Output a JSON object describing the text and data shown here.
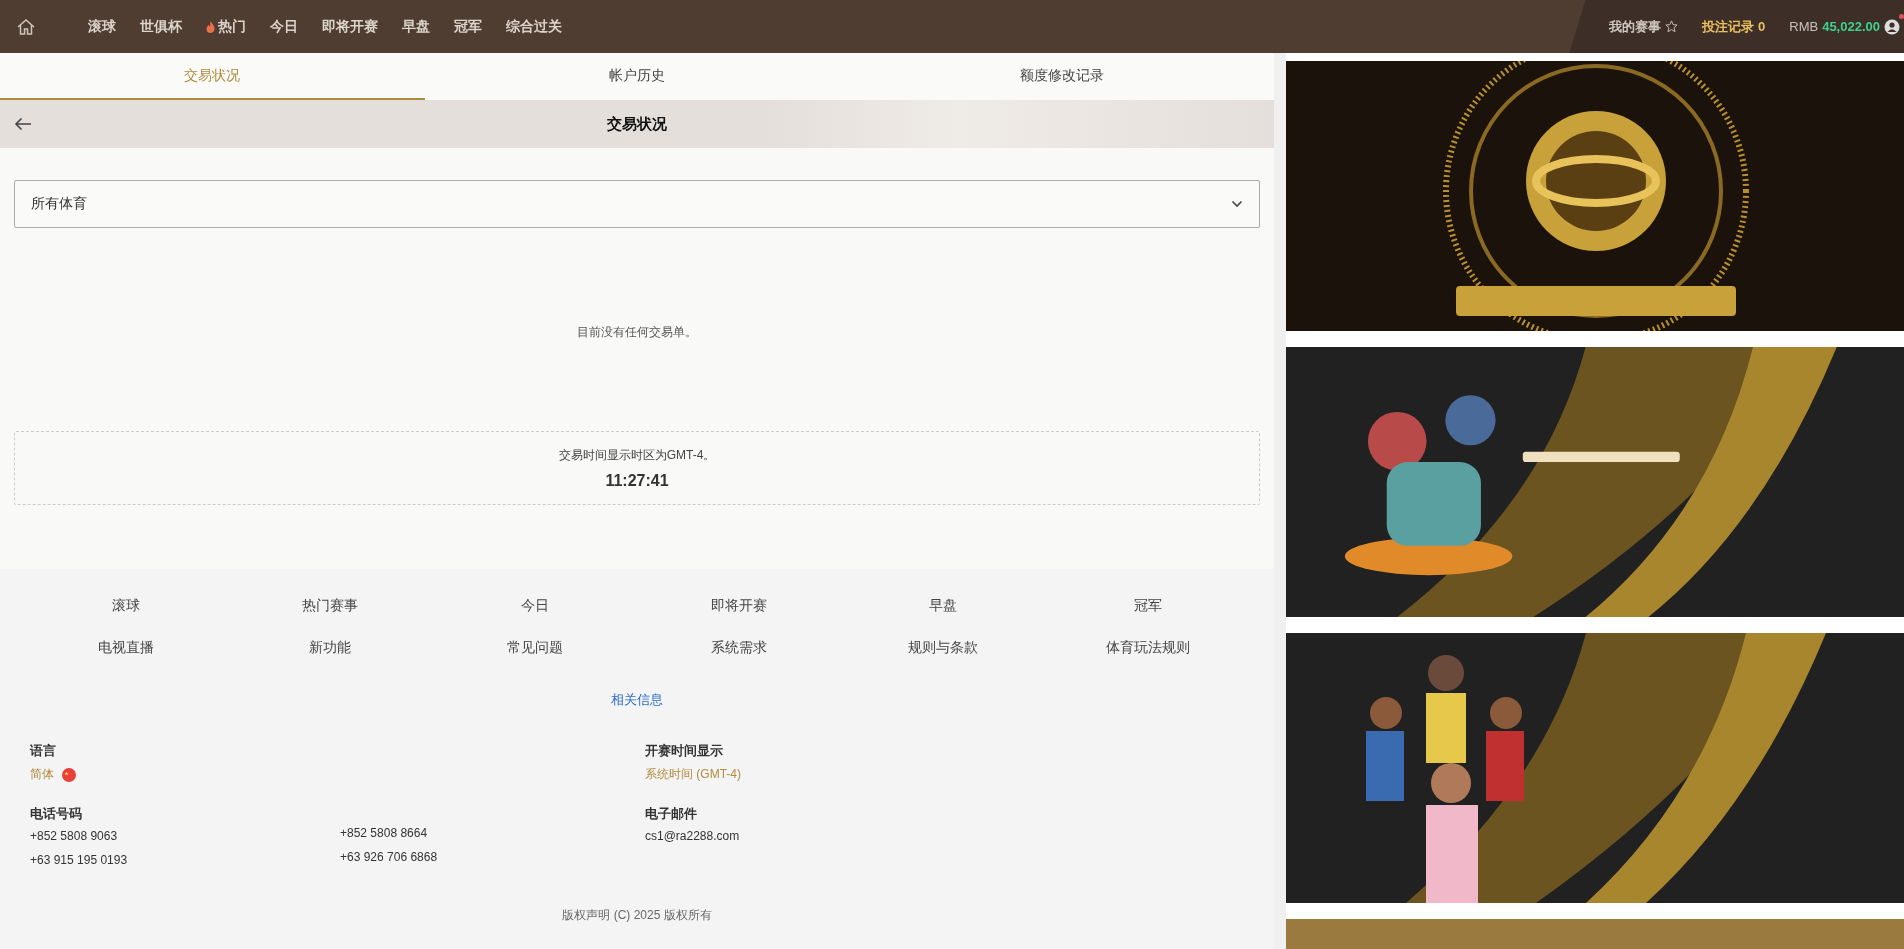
{
  "nav": {
    "items": [
      {
        "label": "滚球",
        "kind": "plain"
      },
      {
        "label": "世俱杯",
        "kind": "plain"
      },
      {
        "label": "热门",
        "kind": "hot"
      },
      {
        "label": "今日",
        "kind": "plain"
      },
      {
        "label": "即将开赛",
        "kind": "plain"
      },
      {
        "label": "早盘",
        "kind": "plain"
      },
      {
        "label": "冠军",
        "kind": "plain"
      },
      {
        "label": "综合过关",
        "kind": "plain"
      }
    ],
    "my_events": "我的赛事",
    "bet_record": "投注记录",
    "bet_count": "0",
    "currency": "RMB",
    "balance": "45,022.00",
    "notification": true
  },
  "tabs": [
    {
      "label": "交易状况",
      "selected": true
    },
    {
      "label": "帐户历史",
      "selected": false
    },
    {
      "label": "额度修改记录",
      "selected": false
    }
  ],
  "page_title": "交易状况",
  "sport_select": {
    "value": "所有体育"
  },
  "empty_message": "目前没有任何交易单。",
  "timezone": {
    "note": "交易时间显示时区为GMT-4。",
    "time": "11:27:41"
  },
  "footer": {
    "links": [
      "滚球",
      "热门赛事",
      "今日",
      "即将开赛",
      "早盘",
      "冠军",
      "电视直播",
      "新功能",
      "常见问题",
      "系统需求",
      "规则与条款",
      "体育玩法规则"
    ],
    "related": "相关信息",
    "language": {
      "label": "语言",
      "value": "简体"
    },
    "time_display": {
      "label": "开赛时间显示",
      "value": "系统时间 (GMT-4)"
    },
    "phone": {
      "label": "电话号码",
      "numbers": [
        "+852 5808 9063",
        "+852 5808 8664",
        "+63 915 195 0193",
        "+63 926 706 6868"
      ]
    },
    "email": {
      "label": "电子邮件",
      "value": "cs1@ra2288.com"
    },
    "copyright": "版权声明 (C) 2025 版权所有"
  }
}
